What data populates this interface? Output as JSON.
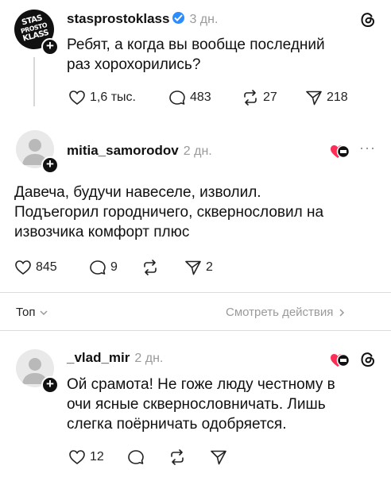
{
  "original_post": {
    "avatar_lines": [
      "STAS",
      "PROSTO",
      "KLASS"
    ],
    "username": "stasprostoklass",
    "time": "3 дн.",
    "text_line1": "Ребят, а когда вы вообще последний",
    "text_line2": "раз хорохорились?",
    "likes": "1,6 тыс.",
    "comments": "483",
    "reposts": "27",
    "shares": "218"
  },
  "reply1": {
    "username": "mitia_samorodov",
    "time": "2 дн.",
    "text_line1": "Давеча, будучи навеселе, изволил.",
    "text_line2": "Подъегорил городничего, сквернословил на",
    "text_line3": "извозчика комфорт плюс",
    "likes": "845",
    "comments": "9",
    "shares": "2"
  },
  "sort_bar": {
    "sort_label": "Топ",
    "activity_label": "Смотреть действия"
  },
  "reply2": {
    "username": "_vlad_mir",
    "time": "2 дн.",
    "text_line1": "Ой срамота! Не гоже люду честному в",
    "text_line2": "очи ясные сквернословничать. Лишь",
    "text_line3": "слегка поёрничать одобряется.",
    "likes": "12"
  },
  "colors": {
    "verified": "#2a8cff",
    "muted": "#9a9a9a",
    "text": "#111111"
  },
  "icons": [
    "threads-logo-icon",
    "verified-icon",
    "heart-icon",
    "comment-icon",
    "repost-icon",
    "share-icon",
    "more-icon",
    "liked-by-author-icon",
    "chevron-down-icon",
    "chevron-right-icon",
    "plus-icon",
    "avatar-placeholder-icon"
  ]
}
